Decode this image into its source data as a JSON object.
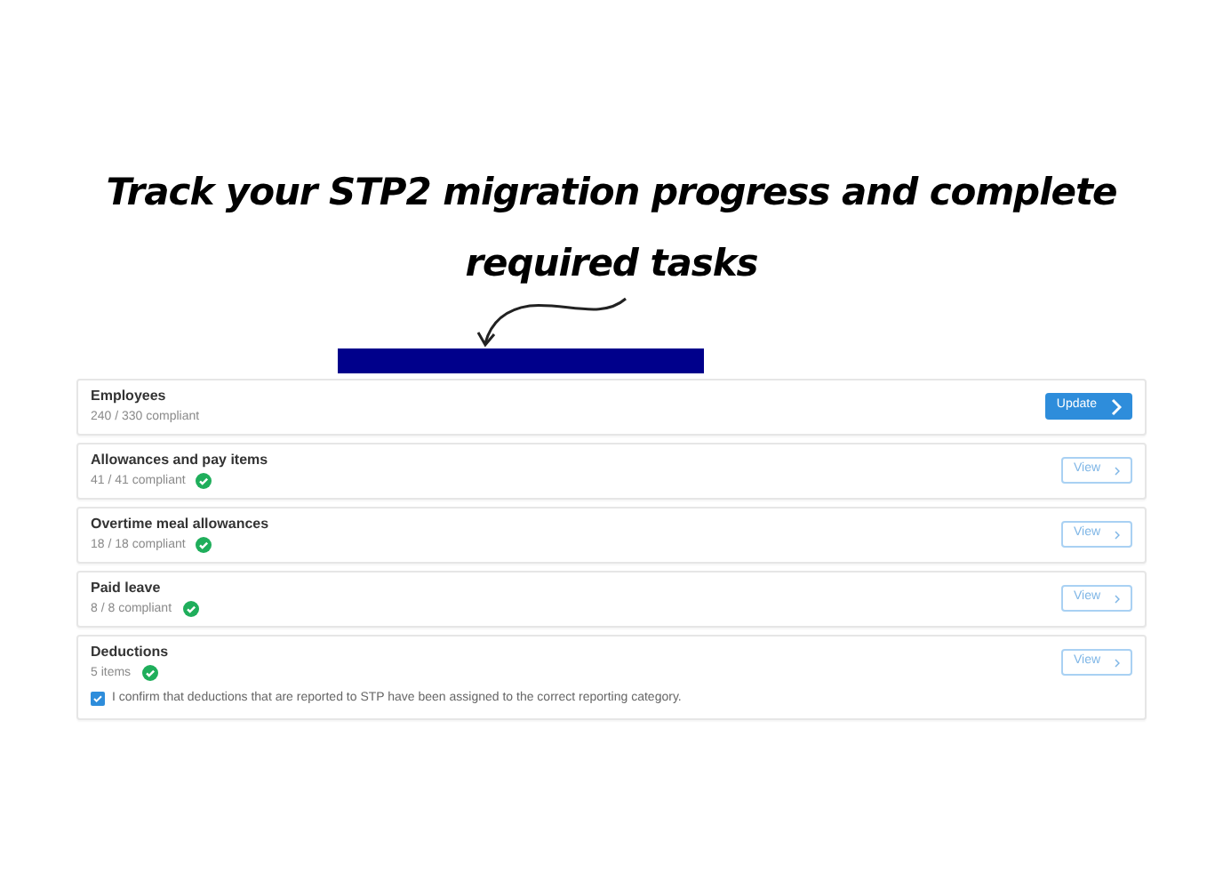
{
  "heading": [
    "Track your STP2 migration progress and complete",
    "required tasks"
  ],
  "tasks": [
    {
      "title": "Employees",
      "status": "240 / 330 compliant",
      "complete": false,
      "action": {
        "label": "Update",
        "kind": "primary"
      }
    },
    {
      "title": "Allowances and pay items",
      "status": "41 / 41 compliant",
      "complete": true,
      "action": {
        "label": "View",
        "kind": "outline"
      }
    },
    {
      "title": "Overtime meal allowances",
      "status": "18 / 18 compliant",
      "complete": true,
      "action": {
        "label": "View",
        "kind": "outline"
      }
    },
    {
      "title": "Paid leave",
      "status": "8 / 8 compliant",
      "complete": true,
      "action": {
        "label": "View",
        "kind": "outline"
      }
    },
    {
      "title": "Deductions",
      "status": "5 items",
      "complete": true,
      "action": {
        "label": "View",
        "kind": "outline"
      },
      "confirm": {
        "label": "I confirm that deductions that are reported to STP have been assigned to the correct reporting category.",
        "checked": true
      }
    }
  ]
}
